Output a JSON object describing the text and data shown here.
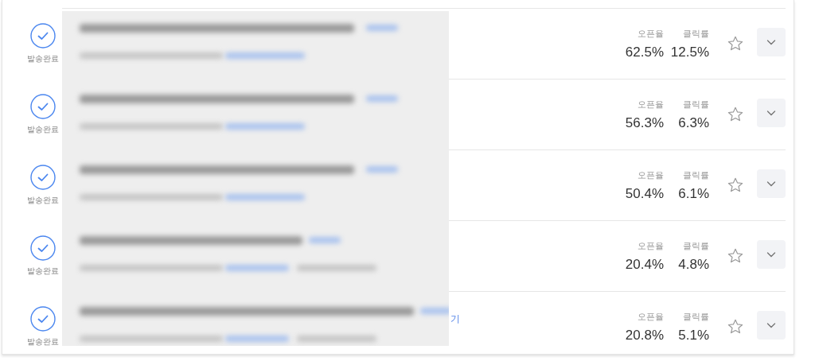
{
  "campaigns": [
    {
      "status": "발송완료",
      "open_label": "오픈율",
      "open_rate": "62.5%",
      "click_label": "클릭률",
      "click_rate": "12.5%",
      "starred": false
    },
    {
      "status": "발송완료",
      "open_label": "오픈율",
      "open_rate": "56.3%",
      "click_label": "클릭률",
      "click_rate": "6.3%",
      "starred": false
    },
    {
      "status": "발송완료",
      "open_label": "오픈율",
      "open_rate": "50.4%",
      "click_label": "클릭률",
      "click_rate": "6.1%",
      "starred": false
    },
    {
      "status": "발송완료",
      "open_label": "오픈율",
      "open_rate": "20.4%",
      "click_label": "클릭률",
      "click_rate": "4.8%",
      "starred": false
    },
    {
      "status": "발송완료",
      "open_label": "오픈율",
      "open_rate": "20.8%",
      "click_label": "클릭률",
      "click_rate": "5.1%",
      "starred": false,
      "preview_link_tail": "기"
    }
  ]
}
